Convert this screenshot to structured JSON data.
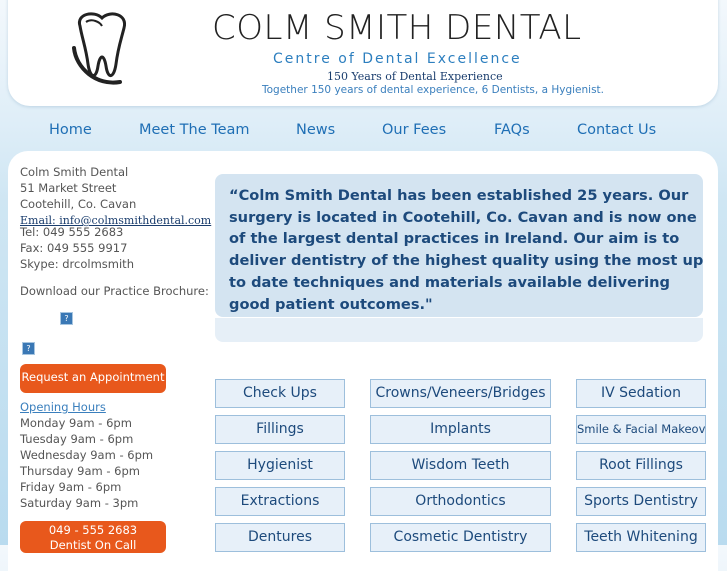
{
  "header": {
    "brand": "COLM SMITH DENTAL",
    "tagline": "Centre of Dental Excellence",
    "years": "150 Years of Dental Experience",
    "together": "Together 150 years of dental experience, 6 Dentists, a Hygienist."
  },
  "nav": {
    "items": [
      "Home",
      "Meet The Team",
      "News",
      "Our Fees",
      "FAQs",
      "Contact Us"
    ]
  },
  "sidebar": {
    "name": "Colm Smith Dental",
    "street": "51 Market Street",
    "town": "Cootehill, Co. Cavan",
    "email": "Email: info@colmsmithdental.com",
    "tel": "Tel: 049 555 2683",
    "fax": "Fax: 049 555 9917",
    "skype": "Skype: drcolmsmith",
    "brochure": "Download our Practice Brochure:",
    "broken_image": "?",
    "appointment": "Request an Appointment",
    "hours_title": "Opening Hours",
    "hours": [
      "Monday 9am - 6pm",
      "Tuesday 9am - 6pm",
      "Wednesday 9am - 6pm",
      "Thursday 9am - 6pm",
      "Friday 9am - 6pm",
      "Saturday 9am - 3pm"
    ],
    "oncall_phone": "049 - 555 2683",
    "oncall_label": "Dentist On Call"
  },
  "quote": "“Colm Smith Dental has been established 25 years. Our surgery is located in Cootehill, Co. Cavan and is now one of the largest dental practices in Ireland. Our aim is to deliver dentistry of the highest quality using the most up to date techniques and materials available delivering good patient outcomes.\"",
  "services": {
    "col1": [
      "Check Ups",
      "Fillings",
      "Hygienist",
      "Extractions",
      "Dentures"
    ],
    "col2": [
      "Crowns/Veneers/Bridges",
      "Implants",
      "Wisdom Teeth",
      "Orthodontics",
      "Cosmetic Dentistry"
    ],
    "col3": [
      "IV Sedation",
      "Smile & Facial Makeover",
      "Root Fillings",
      "Sports Dentistry",
      "Teeth Whitening"
    ]
  },
  "colors": {
    "nav_link": "#1f6fb5",
    "quote_text": "#1d4a7c",
    "orange": "#e8581c",
    "tagline": "#2d7fbf"
  }
}
